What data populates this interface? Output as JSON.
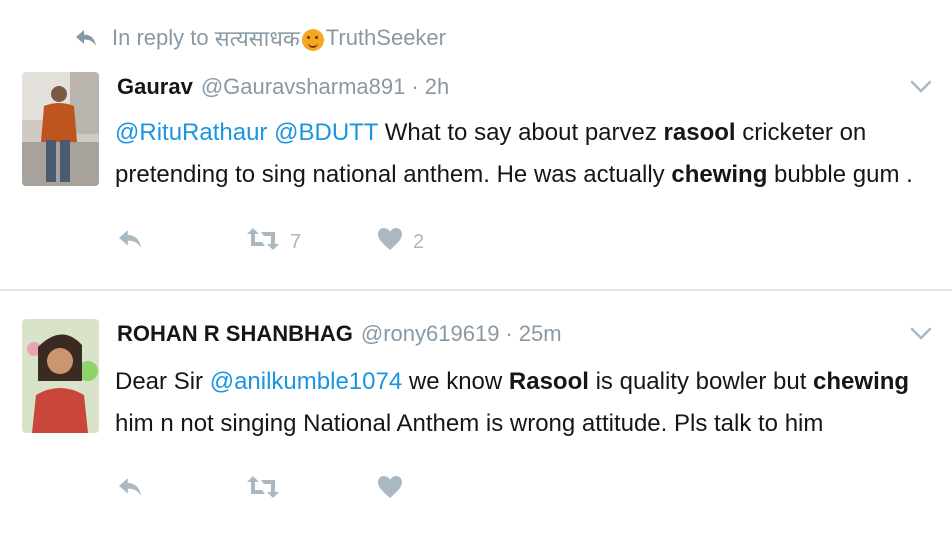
{
  "reply_context": {
    "prefix": "In reply to",
    "name_devanagari": "सत्यसाधक",
    "name_latin": "TruthSeeker"
  },
  "tweets": [
    {
      "name": "Gaurav",
      "handle": "@Gauravsharma891",
      "separator": "·",
      "time": "2h",
      "text_parts": {
        "m1": "@RituRathaur",
        "m2": "@BDUTT",
        "t1": "What to say about parvez",
        "b1": "rasool",
        "t2": "cricketer on pretending to sing national anthem. He was actually",
        "b2": "chewing",
        "t3": "bubble gum ."
      },
      "retweets": "7",
      "likes": "2"
    },
    {
      "name": "ROHAN R SHANBHAG",
      "handle": "@rony619619",
      "separator": "·",
      "time": "25m",
      "text_parts": {
        "t0": "Dear Sir",
        "m1": "@anilkumble1074",
        "t1": "we know",
        "b1": "Rasool",
        "t2": "is quality bowler but",
        "b2": "chewing",
        "t3": "him n not singing National Anthem is wrong attitude. Pls talk to him"
      },
      "retweets": "",
      "likes": ""
    }
  ],
  "icons": {
    "reply_context": "reply-arrow-icon",
    "caret": "chevron-down-icon",
    "reply": "reply-icon",
    "retweet": "retweet-icon",
    "like": "heart-icon"
  },
  "colors": {
    "mention": "#1b95e0",
    "muted": "#8899a6",
    "action": "#aab8c2",
    "divider": "#e1e8ed"
  }
}
